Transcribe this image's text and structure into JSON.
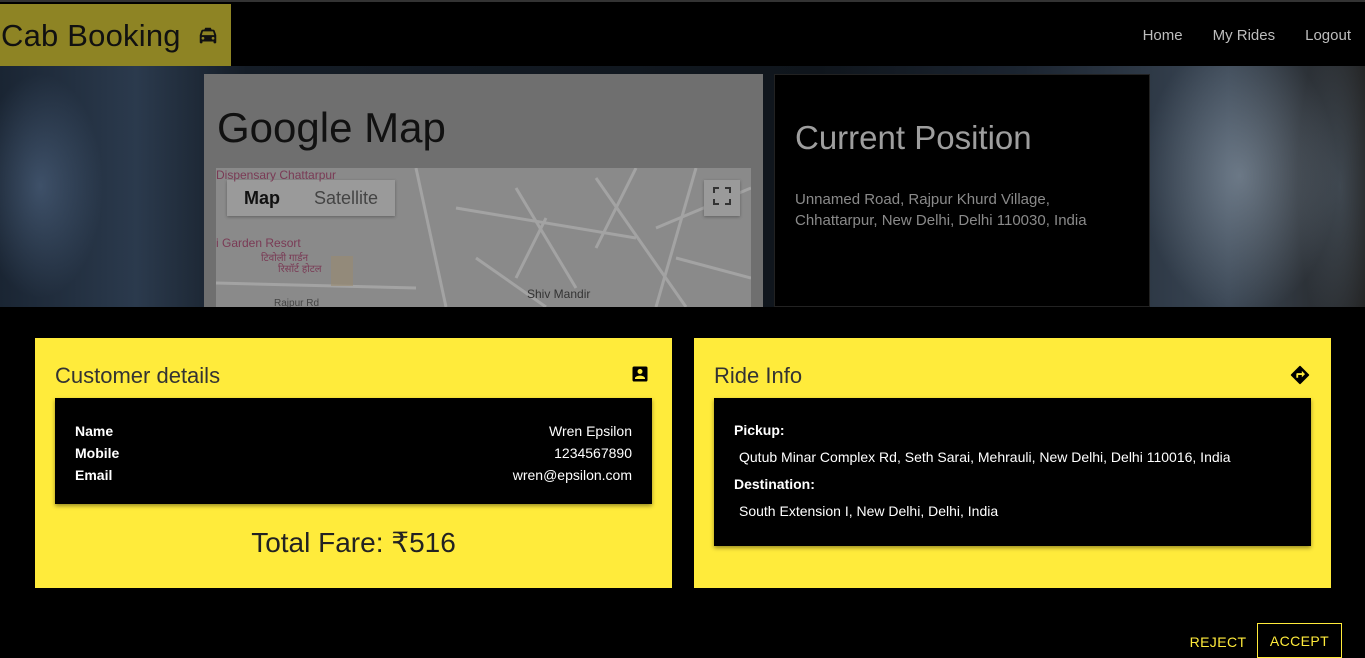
{
  "header": {
    "brand": "Cab Booking",
    "brand_icon": "taxi-icon",
    "nav": [
      "Home",
      "My Rides",
      "Logout"
    ]
  },
  "map": {
    "title": "Google Map",
    "toggle": [
      "Map",
      "Satellite"
    ],
    "labels": {
      "place1": "Dispensary Chattarpur",
      "place2": "i Garden Resort",
      "place2_sub1": "टिवोली गार्डन",
      "place2_sub2": "रिसॉर्ट होटल",
      "place3": "Shiv Mandir",
      "road": "Rajpur Rd"
    }
  },
  "position": {
    "title": "Current Position",
    "address": "Unnamed Road, Rajpur Khurd Village, Chhattarpur, New Delhi, Delhi 110030, India"
  },
  "customer": {
    "title": "Customer details",
    "icon": "account-box-icon",
    "rows": [
      {
        "label": "Name",
        "value": "Wren Epsilon"
      },
      {
        "label": "Mobile",
        "value": "1234567890"
      },
      {
        "label": "Email",
        "value": "wren@epsilon.com"
      }
    ],
    "fare": "Total Fare: ₹516"
  },
  "ride": {
    "title": "Ride Info",
    "icon": "directions-icon",
    "pickup_label": "Pickup:",
    "pickup": "Qutub Minar Complex Rd, Seth Sarai, Mehrauli, New Delhi, Delhi 110016, India",
    "destination_label": "Destination:",
    "destination": "South Extension I, New Delhi, Delhi, India"
  },
  "actions": {
    "reject": "REJECT",
    "accept": "ACCEPT"
  },
  "colors": {
    "accent": "#ffeb3b",
    "brand_bg": "#8e8424"
  }
}
